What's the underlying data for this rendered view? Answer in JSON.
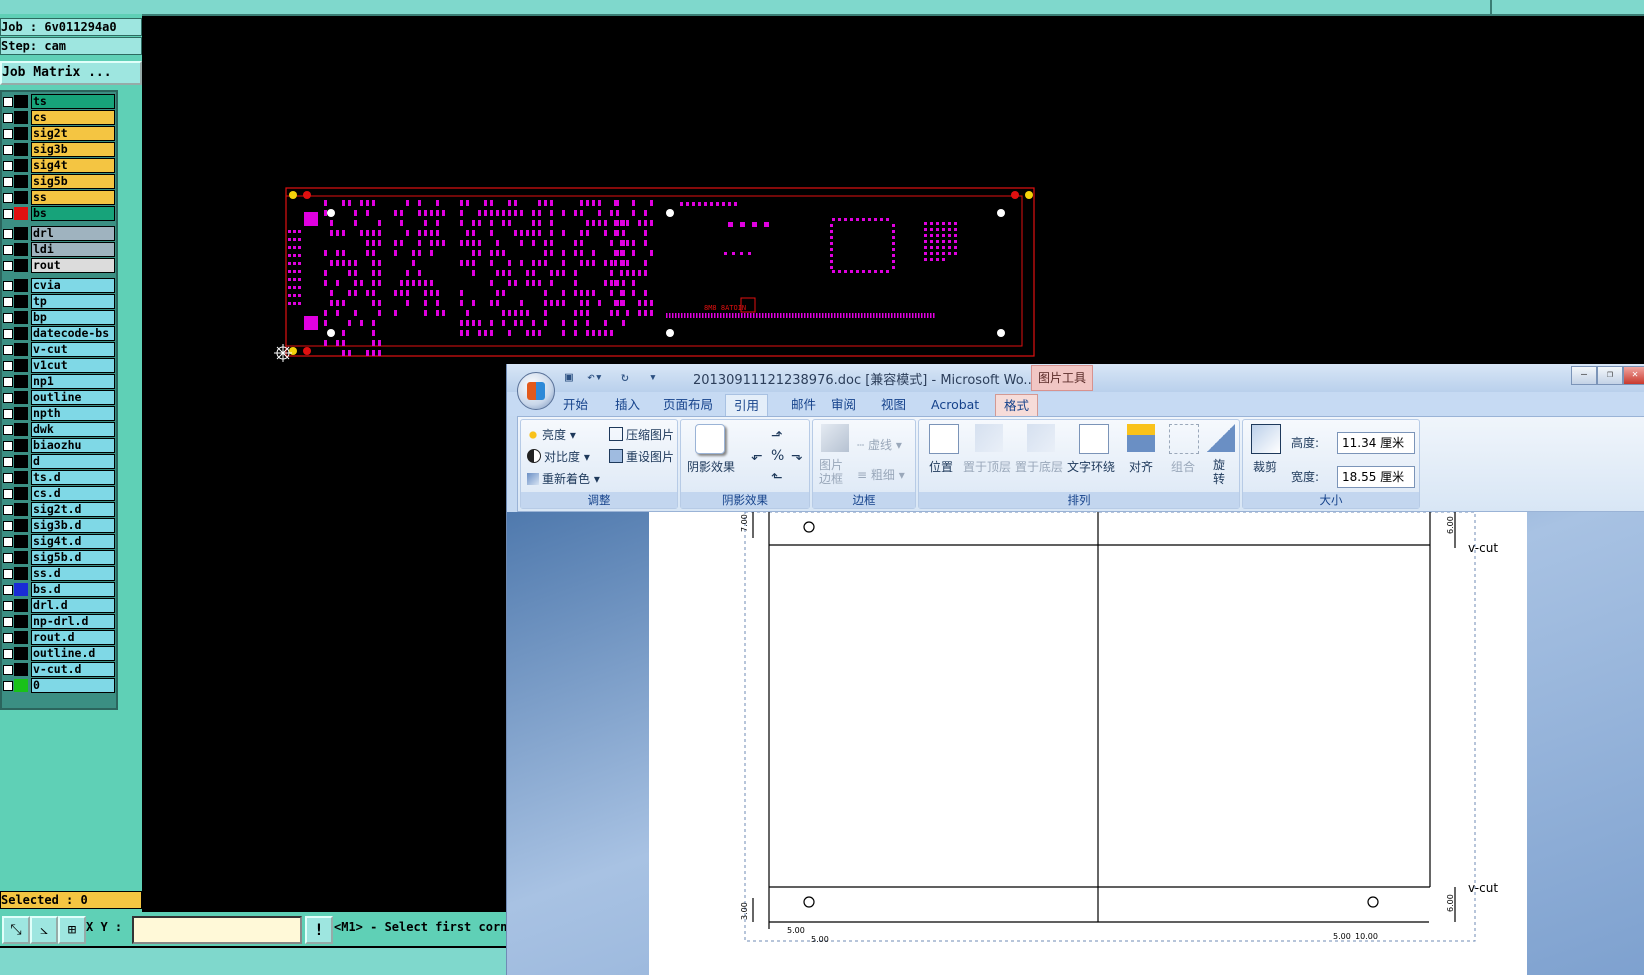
{
  "cam": {
    "job_label": "Job : 6v011294a0",
    "step_label": "Step: cam",
    "job_matrix_button": "Job Matrix ...",
    "layers": [
      {
        "name": "ts",
        "color": "#17a37a",
        "swatch": "#000"
      },
      {
        "name": "cs",
        "color": "#f4c542",
        "swatch": "#000"
      },
      {
        "name": "sig2t",
        "color": "#f4c542",
        "swatch": "#000"
      },
      {
        "name": "sig3b",
        "color": "#f4c542",
        "swatch": "#000"
      },
      {
        "name": "sig4t",
        "color": "#f4c542",
        "swatch": "#000"
      },
      {
        "name": "sig5b",
        "color": "#f4c542",
        "swatch": "#000"
      },
      {
        "name": "ss",
        "color": "#f4c542",
        "swatch": "#000"
      },
      {
        "name": "bs",
        "color": "#17a37a",
        "swatch": "#e01010"
      },
      {
        "name": "drl",
        "color": "#9fb3bf",
        "swatch": "#000"
      },
      {
        "name": "ldi",
        "color": "#9fb3bf",
        "swatch": "#000"
      },
      {
        "name": "rout",
        "color": "#dcdcdc",
        "swatch": "#000"
      },
      {
        "name": "cvia",
        "color": "#7fd8e6",
        "swatch": "#000"
      },
      {
        "name": "tp",
        "color": "#7fd8e6",
        "swatch": "#000"
      },
      {
        "name": "bp",
        "color": "#7fd8e6",
        "swatch": "#000"
      },
      {
        "name": "datecode-bs",
        "color": "#7fd8e6",
        "swatch": "#000"
      },
      {
        "name": "v-cut",
        "color": "#7fd8e6",
        "swatch": "#000"
      },
      {
        "name": "v1cut",
        "color": "#7fd8e6",
        "swatch": "#000"
      },
      {
        "name": "np1",
        "color": "#7fd8e6",
        "swatch": "#000"
      },
      {
        "name": "outline",
        "color": "#7fd8e6",
        "swatch": "#000"
      },
      {
        "name": "npth",
        "color": "#7fd8e6",
        "swatch": "#000"
      },
      {
        "name": "dwk",
        "color": "#7fd8e6",
        "swatch": "#000"
      },
      {
        "name": "biaozhu",
        "color": "#7fd8e6",
        "swatch": "#000"
      },
      {
        "name": "d",
        "color": "#7fd8e6",
        "swatch": "#000"
      },
      {
        "name": "ts.d",
        "color": "#7fd8e6",
        "swatch": "#000"
      },
      {
        "name": "cs.d",
        "color": "#7fd8e6",
        "swatch": "#000"
      },
      {
        "name": "sig2t.d",
        "color": "#7fd8e6",
        "swatch": "#000"
      },
      {
        "name": "sig3b.d",
        "color": "#7fd8e6",
        "swatch": "#000"
      },
      {
        "name": "sig4t.d",
        "color": "#7fd8e6",
        "swatch": "#000"
      },
      {
        "name": "sig5b.d",
        "color": "#7fd8e6",
        "swatch": "#000"
      },
      {
        "name": "ss.d",
        "color": "#7fd8e6",
        "swatch": "#000"
      },
      {
        "name": "bs.d",
        "color": "#7fd8e6",
        "swatch": "#1a2bd6"
      },
      {
        "name": "drl.d",
        "color": "#7fd8e6",
        "swatch": "#000"
      },
      {
        "name": "np-drl.d",
        "color": "#7fd8e6",
        "swatch": "#000"
      },
      {
        "name": "rout.d",
        "color": "#7fd8e6",
        "swatch": "#000"
      },
      {
        "name": "outline.d",
        "color": "#7fd8e6",
        "swatch": "#000"
      },
      {
        "name": "v-cut.d",
        "color": "#7fd8e6",
        "swatch": "#000"
      },
      {
        "name": "0",
        "color": "#7fd8e6",
        "swatch": "#19c219"
      }
    ],
    "selected_label": "Selected : 0",
    "xy_label": "X Y :",
    "xy_value": "",
    "status_message": "<M1> - Select first corn",
    "warn_symbol": "!"
  },
  "word": {
    "title": "20130911121238976.doc [兼容模式] - Microsoft Wo...",
    "picture_tools_label": "图片工具",
    "tabs": [
      "开始",
      "插入",
      "页面布局",
      "引用",
      "邮件",
      "审阅",
      "视图",
      "Acrobat",
      "格式"
    ],
    "active_tab": "格式",
    "ribbon": {
      "adjust": {
        "brightness": "亮度",
        "contrast": "对比度",
        "recolor": "重新着色",
        "compress": "压缩图片",
        "reset": "重设图片",
        "label": "调整"
      },
      "shadow": {
        "effects": "阴影效果",
        "label": "阴影效果"
      },
      "border": {
        "picture_border": "图片\n边框",
        "dashes": "虚线",
        "weight": "粗细",
        "label": "边框"
      },
      "arrange": {
        "position": "位置",
        "bring_front": "置于顶层",
        "send_back": "置于底层",
        "text_wrap": "文字环绕",
        "align": "对齐",
        "group": "组合",
        "rotate": "旋转",
        "label": "排列"
      },
      "size": {
        "crop": "裁剪",
        "height_label": "高度:",
        "height_value": "11.34 厘米",
        "width_label": "宽度:",
        "width_value": "18.55 厘米",
        "label": "大小"
      }
    },
    "drawing": {
      "vcut_top": "v-cut",
      "vcut_bottom": "v-cut",
      "dims": [
        "7.00",
        "6.00",
        "3.00",
        "5.00",
        "5.00",
        "5.00",
        "10.00",
        "6.00"
      ]
    }
  }
}
